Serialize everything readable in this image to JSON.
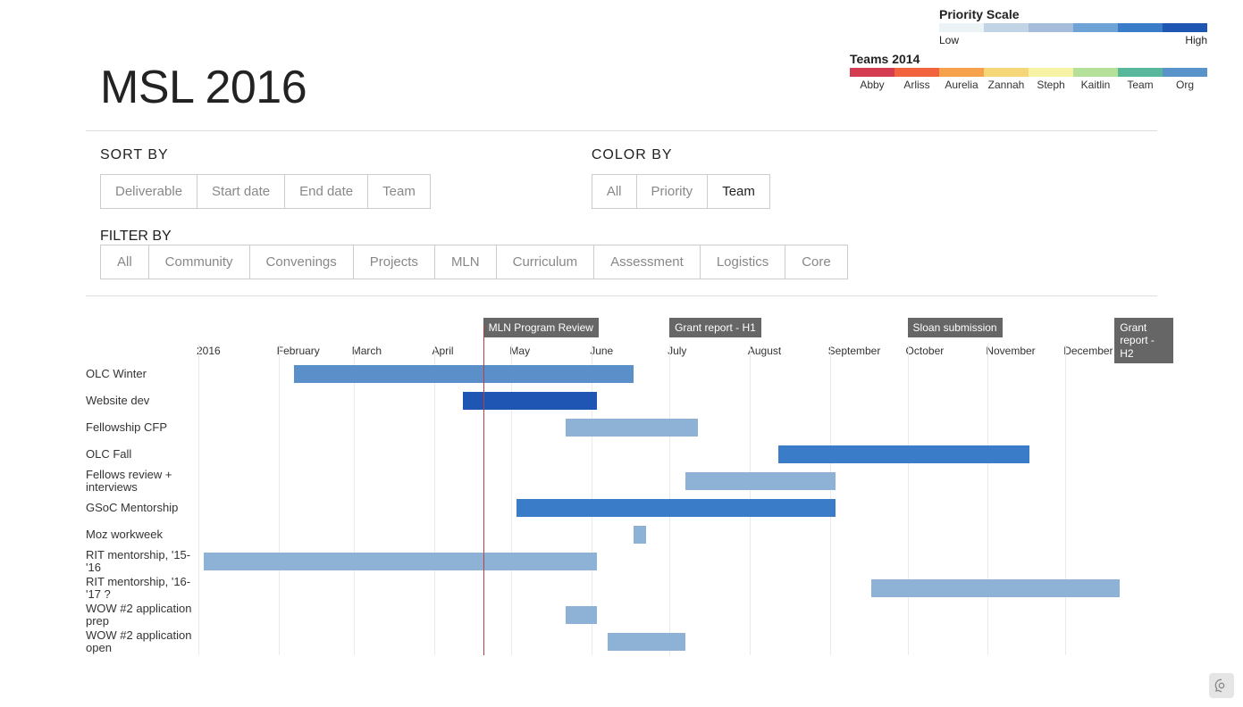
{
  "title": "MSL 2016",
  "legends": {
    "priority": {
      "title": "Priority Scale",
      "low_label": "Low",
      "high_label": "High",
      "colors": [
        "#ebf3f7",
        "#c3d3e6",
        "#a5bcdb",
        "#6fa2d5",
        "#3a7cc7",
        "#1f55b3"
      ]
    },
    "teams": {
      "title": "Teams 2014",
      "items": [
        {
          "name": "Abby",
          "color": "#d43d51"
        },
        {
          "name": "Arliss",
          "color": "#f0633c"
        },
        {
          "name": "Aurelia",
          "color": "#f6a14c"
        },
        {
          "name": "Zannah",
          "color": "#f5d77a"
        },
        {
          "name": "Steph",
          "color": "#f6f3a6"
        },
        {
          "name": "Kaitlin",
          "color": "#b5e09a"
        },
        {
          "name": "Team",
          "color": "#59b89c"
        },
        {
          "name": "Org",
          "color": "#5a93c9"
        }
      ]
    }
  },
  "controls": {
    "sort_title": "SORT BY",
    "sort_options": [
      "Deliverable",
      "Start date",
      "End date",
      "Team"
    ],
    "color_title": "COLOR BY",
    "color_options": [
      "All",
      "Priority",
      "Team"
    ],
    "color_active": "Team",
    "filter_title": "FILTER BY",
    "filter_options": [
      "All",
      "Community",
      "Convenings",
      "Projects",
      "MLN",
      "Curriculum",
      "Assessment",
      "Logistics",
      "Core"
    ]
  },
  "chart_data": {
    "type": "gantt",
    "today": "2016-04-20",
    "xaxis": {
      "start": "2016-01-01",
      "end": "2017-01-01",
      "ticks": [
        {
          "label": "2016",
          "date": "2016-01-01"
        },
        {
          "label": "February",
          "date": "2016-02-01"
        },
        {
          "label": "March",
          "date": "2016-03-01"
        },
        {
          "label": "April",
          "date": "2016-04-01"
        },
        {
          "label": "May",
          "date": "2016-05-01"
        },
        {
          "label": "June",
          "date": "2016-06-01"
        },
        {
          "label": "July",
          "date": "2016-07-01"
        },
        {
          "label": "August",
          "date": "2016-08-01"
        },
        {
          "label": "September",
          "date": "2016-09-01"
        },
        {
          "label": "October",
          "date": "2016-10-01"
        },
        {
          "label": "November",
          "date": "2016-11-01"
        },
        {
          "label": "December",
          "date": "2016-12-01"
        }
      ]
    },
    "milestones": [
      {
        "label": "MLN Program Review",
        "date": "2016-04-20"
      },
      {
        "label": "Grant report - H1",
        "date": "2016-07-01"
      },
      {
        "label": "Sloan submission",
        "date": "2016-10-01"
      },
      {
        "label": "Grant report - H2",
        "date": "2016-12-20",
        "multiline": true
      }
    ],
    "rows": [
      {
        "label": "OLC Winter",
        "start": "2016-02-05",
        "end": "2016-06-15",
        "color": "#5a8fc9"
      },
      {
        "label": "Website dev",
        "start": "2016-04-10",
        "end": "2016-06-01",
        "color": "#1f55b3"
      },
      {
        "label": "Fellowship CFP",
        "start": "2016-05-20",
        "end": "2016-07-10",
        "color": "#8eb2d6"
      },
      {
        "label": "OLC Fall",
        "start": "2016-08-10",
        "end": "2016-11-15",
        "color": "#3a7cc7"
      },
      {
        "label": "Fellows review + interviews",
        "start": "2016-07-05",
        "end": "2016-09-01",
        "color": "#8eb2d6"
      },
      {
        "label": "GSoC Mentorship",
        "start": "2016-05-01",
        "end": "2016-09-01",
        "color": "#3a7cc7"
      },
      {
        "label": "Moz workweek",
        "start": "2016-06-15",
        "end": "2016-06-20",
        "color": "#8eb2d6"
      },
      {
        "label": "RIT mentorship, '15-'16",
        "start": "2016-01-01",
        "end": "2016-06-01",
        "color": "#8eb2d6"
      },
      {
        "label": "RIT mentorship, '16-'17 ?",
        "start": "2016-09-15",
        "end": "2016-12-20",
        "color": "#8eb2d6"
      },
      {
        "label": "WOW #2 application prep",
        "start": "2016-05-20",
        "end": "2016-06-01",
        "color": "#8eb2d6"
      },
      {
        "label": "WOW #2 application open",
        "start": "2016-06-05",
        "end": "2016-07-05",
        "color": "#8eb2d6"
      }
    ]
  }
}
